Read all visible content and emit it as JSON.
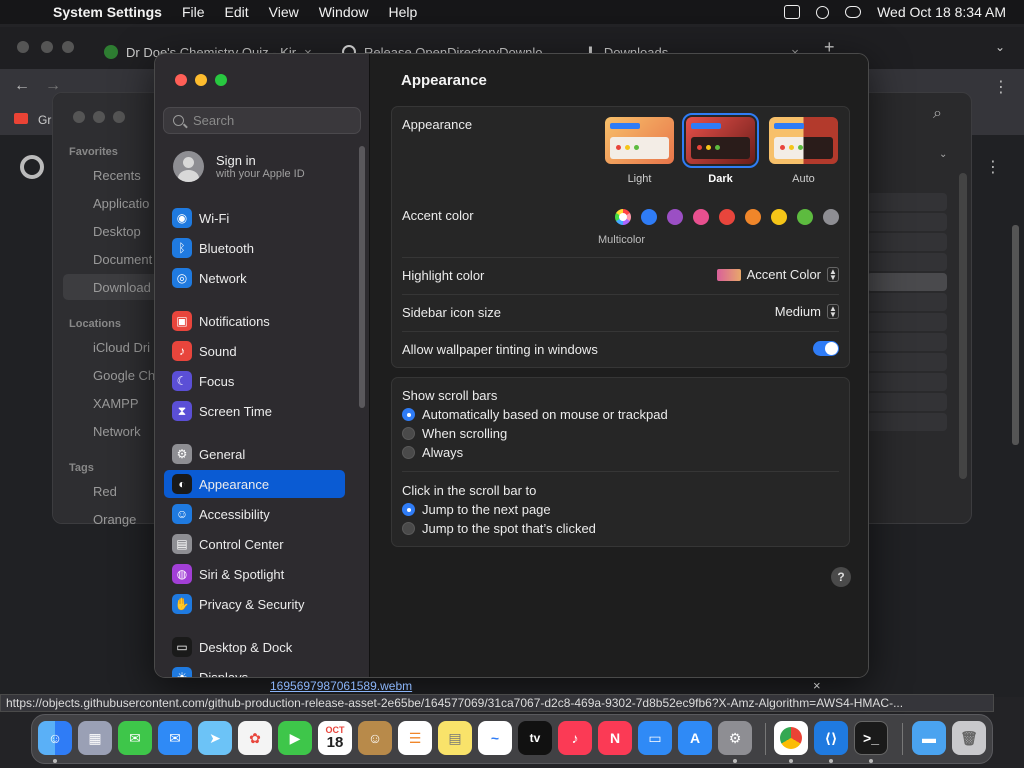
{
  "menubar": {
    "apple": "",
    "app": "System Settings",
    "items": [
      "File",
      "Edit",
      "View",
      "Window",
      "Help"
    ],
    "datetime": "Wed Oct 18  8:34 AM"
  },
  "chrome": {
    "tabs": [
      {
        "label": "Dr Doe's Chemistry Quiz - Kir"
      },
      {
        "label": "Release OpenDirectoryDownlo"
      },
      {
        "label": "Downloads"
      }
    ],
    "bookmark": "Gr",
    "new_tab": "+",
    "close": "×"
  },
  "finder": {
    "sections": [
      {
        "title": "Favorites",
        "items": [
          "Recents",
          "Applicatio",
          "Desktop",
          "Document",
          "Download"
        ]
      },
      {
        "title": "Locations",
        "items": [
          "iCloud Dri",
          "Google Ch",
          "XAMPP",
          "Network"
        ]
      },
      {
        "title": "Tags",
        "items": [
          "Red",
          "Orange"
        ]
      }
    ]
  },
  "settings": {
    "search": {
      "placeholder": "Search"
    },
    "signin": {
      "title": "Sign in",
      "subtitle": "with your Apple ID"
    },
    "nav": [
      {
        "label": "Wi-Fi",
        "color": "#1f7ae0",
        "glyph": "◉"
      },
      {
        "label": "Bluetooth",
        "color": "#1f7ae0",
        "glyph": "ᛒ"
      },
      {
        "label": "Network",
        "color": "#1f7ae0",
        "glyph": "◎"
      },
      {
        "label": "Notifications",
        "color": "#e8453c",
        "glyph": "▣"
      },
      {
        "label": "Sound",
        "color": "#e8453c",
        "glyph": "♪"
      },
      {
        "label": "Focus",
        "color": "#5b4fd6",
        "glyph": "☾"
      },
      {
        "label": "Screen Time",
        "color": "#5b4fd6",
        "glyph": "⧗"
      },
      {
        "label": "General",
        "color": "#8e8e93",
        "glyph": "⚙"
      },
      {
        "label": "Appearance",
        "color": "#1a1a1a",
        "glyph": "◐"
      },
      {
        "label": "Accessibility",
        "color": "#1f7ae0",
        "glyph": "☺"
      },
      {
        "label": "Control Center",
        "color": "#8e8e93",
        "glyph": "▤"
      },
      {
        "label": "Siri & Spotlight",
        "color": "#a23fd6",
        "glyph": "◍"
      },
      {
        "label": "Privacy & Security",
        "color": "#1f7ae0",
        "glyph": "✋"
      },
      {
        "label": "Desktop & Dock",
        "color": "#1a1a1a",
        "glyph": "▭"
      },
      {
        "label": "Displays",
        "color": "#1f7ae0",
        "glyph": "☀"
      }
    ],
    "selected": "Appearance",
    "title": "Appearance",
    "appearance": {
      "label": "Appearance",
      "options": [
        "Light",
        "Dark",
        "Auto"
      ],
      "selected": "Dark"
    },
    "accent": {
      "label": "Accent color",
      "colors": [
        "multicolor",
        "#2f7cf6",
        "#9b4fc4",
        "#e8508f",
        "#e8453c",
        "#f0862a",
        "#f5c518",
        "#5dbb3f",
        "#8e8e93"
      ],
      "caption": "Multicolor"
    },
    "highlight": {
      "label": "Highlight color",
      "value": "Accent Color"
    },
    "sidebar_icon": {
      "label": "Sidebar icon size",
      "value": "Medium"
    },
    "tinting": {
      "label": "Allow wallpaper tinting in windows",
      "on": true
    },
    "scrollbars": {
      "label": "Show scroll bars",
      "options": [
        "Automatically based on mouse or trackpad",
        "When scrolling",
        "Always"
      ],
      "selected": 0
    },
    "click_scroll": {
      "label": "Click in the scroll bar to",
      "options": [
        "Jump to the next page",
        "Jump to the spot that’s clicked"
      ],
      "selected": 0
    },
    "help": "?"
  },
  "download": {
    "filename": "1695697987061589.webm",
    "close": "×"
  },
  "statusbar": {
    "url": "https://objects.githubusercontent.com/github-production-release-asset-2e65be/164577069/31ca7067-d2c8-469a-9302-7d8b52ec9fb6?X-Amz-Algorithm=AWS4-HMAC-..."
  },
  "dock": {
    "calendar_month": "OCT",
    "calendar_day": "18",
    "tv_label": "tv"
  }
}
